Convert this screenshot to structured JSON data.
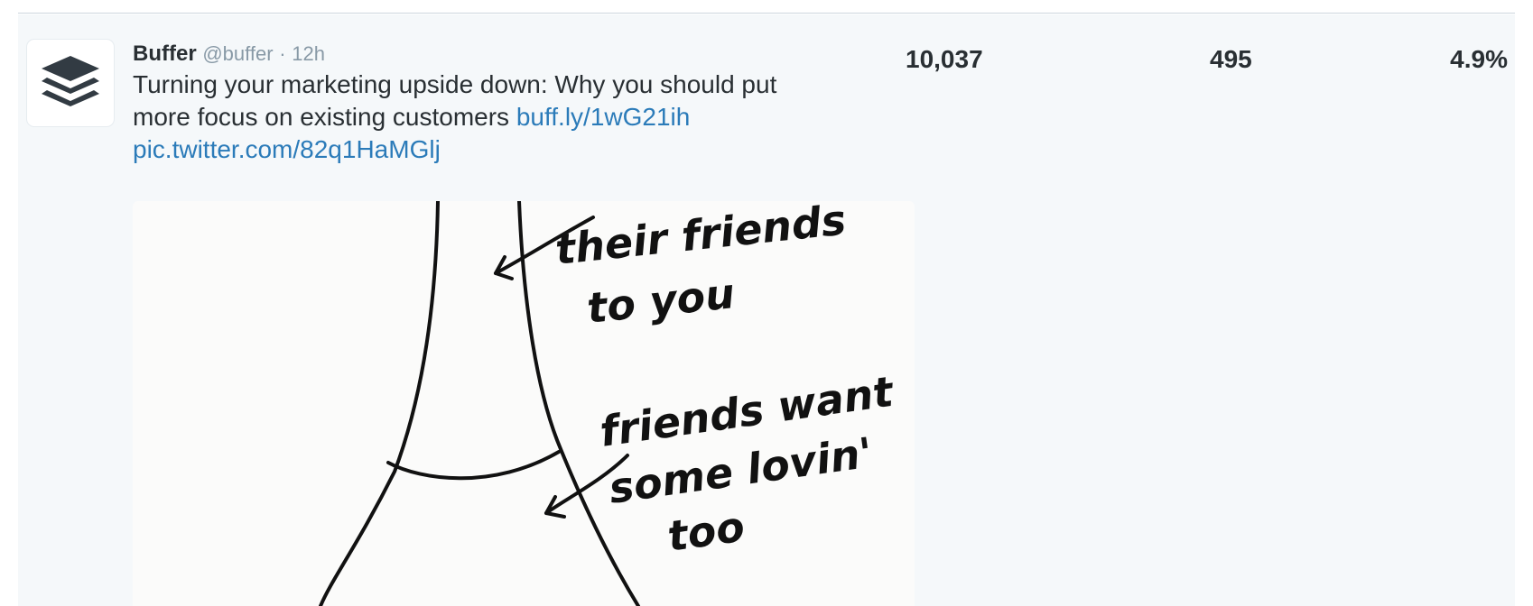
{
  "tweet": {
    "name": "Buffer",
    "handle": "@buffer",
    "separator": "·",
    "time": "12h",
    "text_line1": "Turning your marketing upside down: Why you should put",
    "text_line2_prefix": "more focus on existing customers ",
    "link_url": "buff.ly/1wG21ih",
    "pic_link": "pic.twitter.com/82q1HaMGlj",
    "avatar_icon": "buffer-layers-icon"
  },
  "media": {
    "handwriting": {
      "line1": "their friends",
      "line2": "to you",
      "line3": "friends want",
      "line4": "some lovin'",
      "line5": "too"
    }
  },
  "stats": {
    "impressions": "10,037",
    "engagements": "495",
    "engagement_rate": "4.9%"
  },
  "colors": {
    "link": "#2b7bb9",
    "row_background": "#f5f8fa",
    "muted_text": "#8899a6"
  }
}
